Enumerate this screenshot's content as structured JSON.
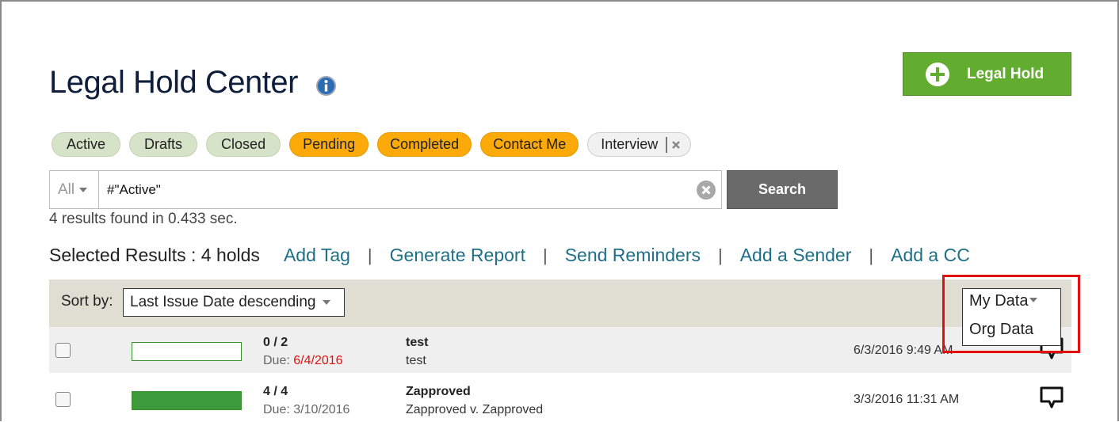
{
  "header": {
    "title": "Legal Hold Center",
    "info_icon": "info-icon",
    "add_button_label": "Legal Hold",
    "add_button_icon": "plus-circle-icon",
    "accent_color": "#62ac2f"
  },
  "filters": [
    {
      "label": "Active",
      "style": "green"
    },
    {
      "label": "Drafts",
      "style": "green"
    },
    {
      "label": "Closed",
      "style": "green"
    },
    {
      "label": "Pending",
      "style": "orange"
    },
    {
      "label": "Completed",
      "style": "orange"
    },
    {
      "label": "Contact Me",
      "style": "orange"
    },
    {
      "label": "Interview",
      "style": "grey",
      "removable": true
    }
  ],
  "search": {
    "scope": "All",
    "query": "#\"Active\"",
    "button_label": "Search",
    "results_text": "4 results found in 0.433 sec."
  },
  "actions": {
    "selected_text": "Selected Results : 4 holds",
    "links": [
      "Add Tag",
      "Generate Report",
      "Send Reminders",
      "Add a Sender",
      "Add a CC"
    ]
  },
  "sort": {
    "label": "Sort by:",
    "value": "Last Issue Date descending"
  },
  "data_scope": {
    "selected": "My Data",
    "options": [
      "Org Data"
    ]
  },
  "rows": [
    {
      "progress": 0.0,
      "count": "0 / 2",
      "due_label": "Due:",
      "due_date": "6/4/2016",
      "overdue": true,
      "name": "test",
      "description": "test",
      "timestamp": "6/3/2016 9:49 AM"
    },
    {
      "progress": 1.0,
      "count": "4 / 4",
      "due_label": "Due:",
      "due_date": "3/10/2016",
      "overdue": false,
      "name": "Zapproved",
      "description": "Zapproved v. Zapproved",
      "timestamp": "3/3/2016 11:31 AM"
    }
  ]
}
